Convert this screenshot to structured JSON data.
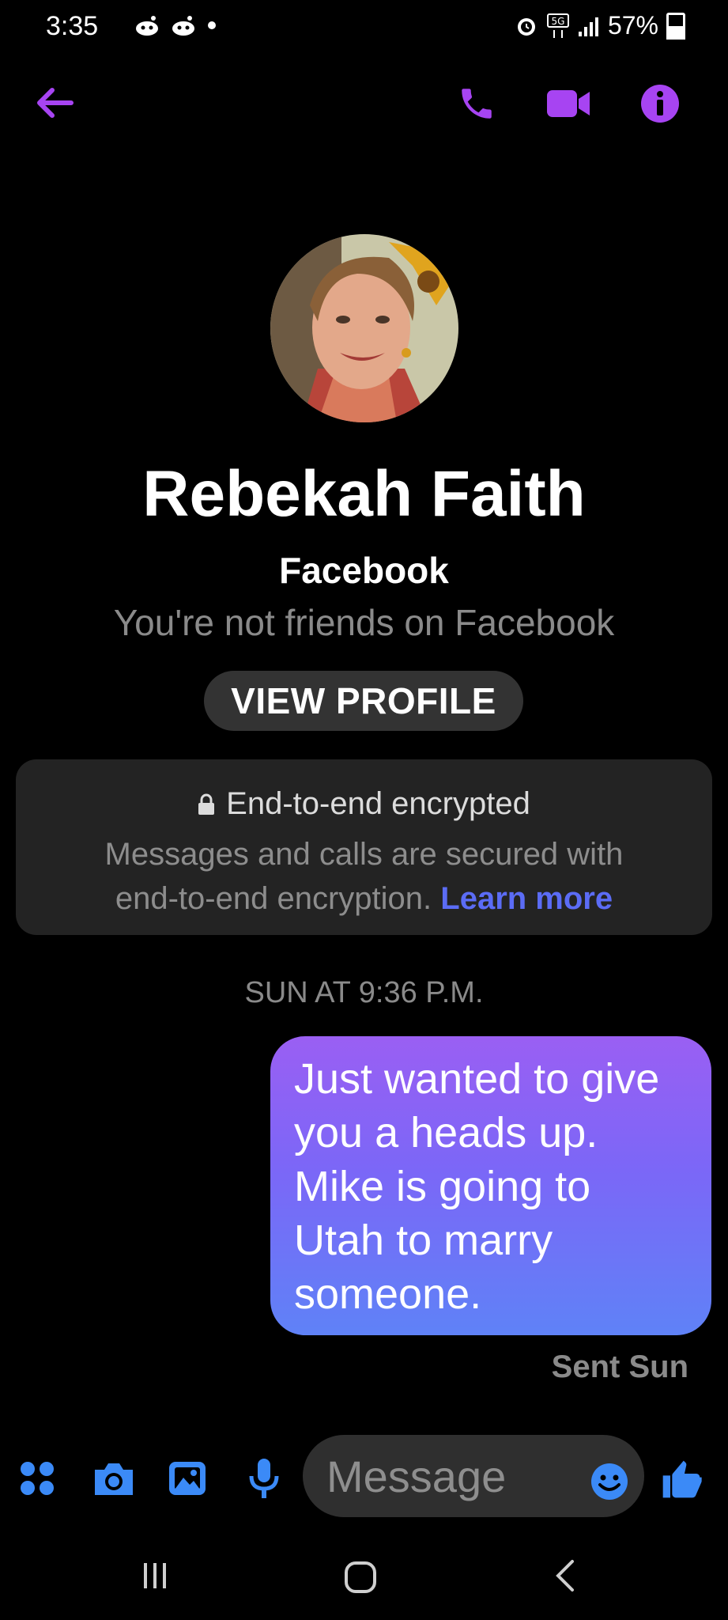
{
  "status_bar": {
    "time": "3:35",
    "battery": "57%"
  },
  "header": {
    "back_icon": "arrow-left-icon",
    "call_icon": "phone-icon",
    "video_icon": "video-camera-icon",
    "info_icon": "info-icon",
    "accent_color": "#a744f2"
  },
  "profile": {
    "name": "Rebekah Faith",
    "platform": "Facebook",
    "relationship": "You're not friends on Facebook",
    "view_profile_label": "VIEW PROFILE"
  },
  "encryption": {
    "title": "End-to-end encrypted",
    "body_line1": "Messages and calls are secured with",
    "body_line2": "end-to-end encryption.",
    "learn_more": "Learn more"
  },
  "conversation": {
    "timestamp": "SUN AT 9:36 P.M.",
    "messages": [
      {
        "lines": [
          "Just wanted to give",
          "you a heads up.",
          "Mike is going to",
          "Utah to marry",
          "someone."
        ],
        "direction": "outgoing"
      }
    ],
    "status": "Sent Sun"
  },
  "composer": {
    "placeholder": "Message",
    "icons": [
      "apps-grid-icon",
      "camera-icon",
      "gallery-icon",
      "microphone-icon",
      "emoji-icon",
      "thumbs-up-icon"
    ],
    "accent_color": "#3b8af7"
  }
}
